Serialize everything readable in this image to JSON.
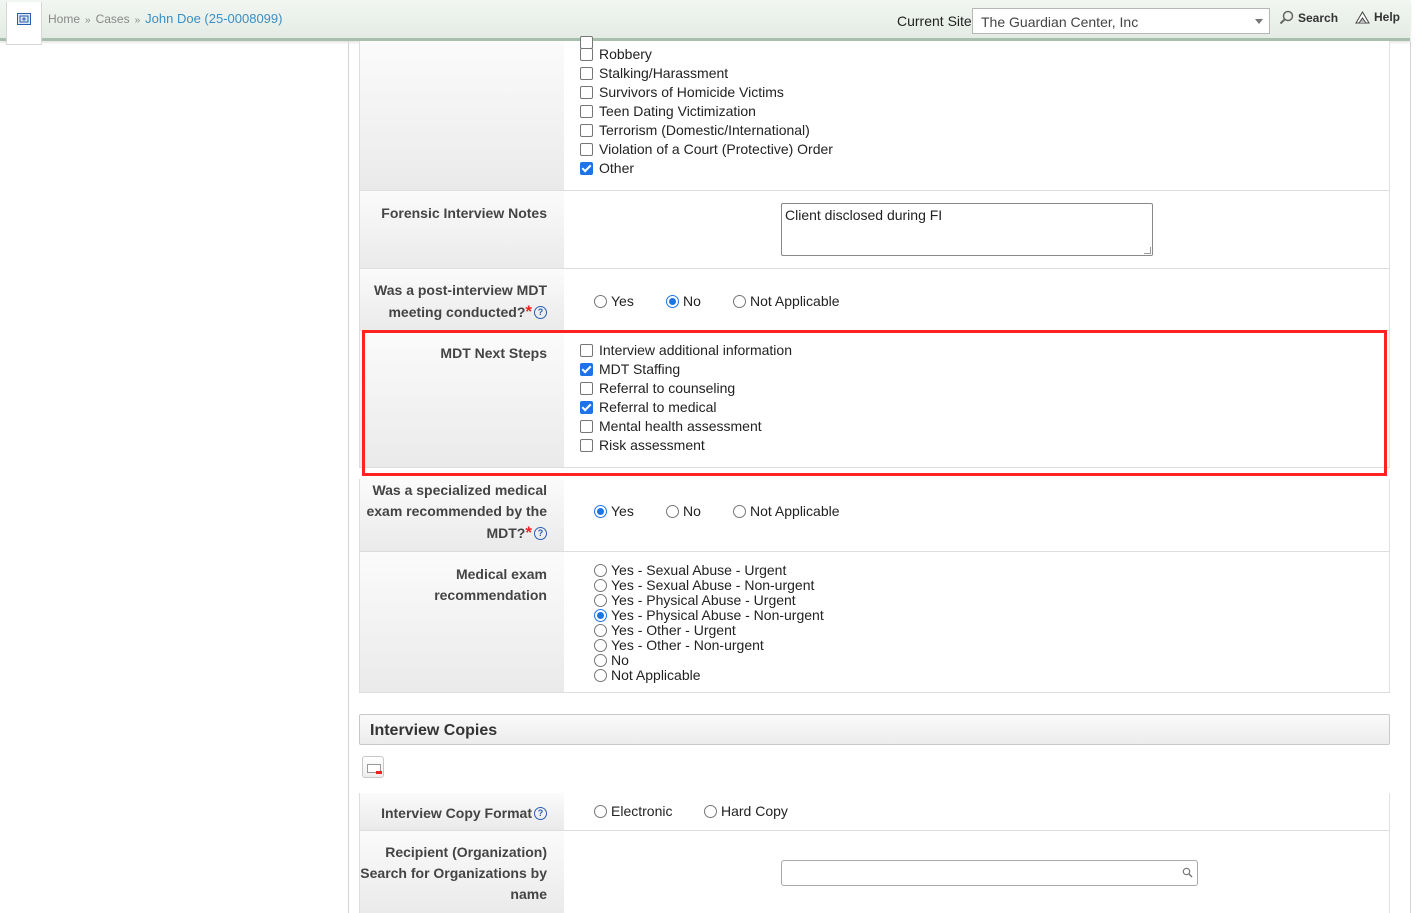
{
  "topbar": {
    "breadcrumbs": [
      "Home",
      "Cases",
      "John Doe (25-0008099)"
    ],
    "breadcrumb_sep": "»",
    "site_label": "Current Site",
    "site_value": "The Guardian Center, Inc",
    "search_label": "Search",
    "help_label": "Help"
  },
  "victimization": {
    "options": [
      {
        "label": "Robbery",
        "checked": false
      },
      {
        "label": "Stalking/Harassment",
        "checked": false
      },
      {
        "label": "Survivors of Homicide Victims",
        "checked": false
      },
      {
        "label": "Teen Dating Victimization",
        "checked": false
      },
      {
        "label": "Terrorism (Domestic/International)",
        "checked": false
      },
      {
        "label": "Violation of a Court (Protective) Order",
        "checked": false
      },
      {
        "label": "Other",
        "checked": true
      }
    ]
  },
  "forensic_notes": {
    "label": "Forensic Interview Notes",
    "value": "Client disclosed during FI"
  },
  "post_interview_mdt": {
    "label_line1": "Was a post-interview MDT",
    "label_line2": "meeting conducted?",
    "required_mark": "*",
    "help": "?",
    "options": [
      {
        "label": "Yes",
        "selected": false
      },
      {
        "label": "No",
        "selected": true
      },
      {
        "label": "Not Applicable",
        "selected": false
      }
    ]
  },
  "mdt_next_steps": {
    "label": "MDT Next Steps",
    "options": [
      {
        "label": "Interview additional information",
        "checked": false
      },
      {
        "label": "MDT Staffing",
        "checked": true
      },
      {
        "label": "Referral to counseling",
        "checked": false
      },
      {
        "label": "Referral to medical",
        "checked": true
      },
      {
        "label": "Mental health assessment",
        "checked": false
      },
      {
        "label": "Risk assessment",
        "checked": false
      }
    ]
  },
  "specialized_exam": {
    "label_line1": "Was a specialized medical",
    "label_line2": "exam recommended by the",
    "label_line3": "MDT?",
    "required_mark": "*",
    "help": "?",
    "options": [
      {
        "label": "Yes",
        "selected": true
      },
      {
        "label": "No",
        "selected": false
      },
      {
        "label": "Not Applicable",
        "selected": false
      }
    ]
  },
  "exam_recommendation": {
    "label_line1": "Medical exam",
    "label_line2": "recommendation",
    "options": [
      {
        "label": "Yes - Sexual Abuse - Urgent",
        "selected": false
      },
      {
        "label": "Yes - Sexual Abuse - Non-urgent",
        "selected": false
      },
      {
        "label": "Yes - Physical Abuse - Urgent",
        "selected": false
      },
      {
        "label": "Yes - Physical Abuse - Non-urgent",
        "selected": true
      },
      {
        "label": "Yes - Other - Urgent",
        "selected": false
      },
      {
        "label": "Yes - Other - Non-urgent",
        "selected": false
      },
      {
        "label": "No",
        "selected": false
      },
      {
        "label": "Not Applicable",
        "selected": false
      }
    ]
  },
  "interview_copies": {
    "title": "Interview Copies",
    "format_label": "Interview Copy Format",
    "help": "?",
    "format_options": [
      {
        "label": "Electronic",
        "selected": false
      },
      {
        "label": "Hard Copy",
        "selected": false
      }
    ],
    "recipient_line1": "Recipient (Organization)",
    "recipient_line2": "Search for Organizations by",
    "recipient_line3": "name",
    "recipient_value": ""
  }
}
